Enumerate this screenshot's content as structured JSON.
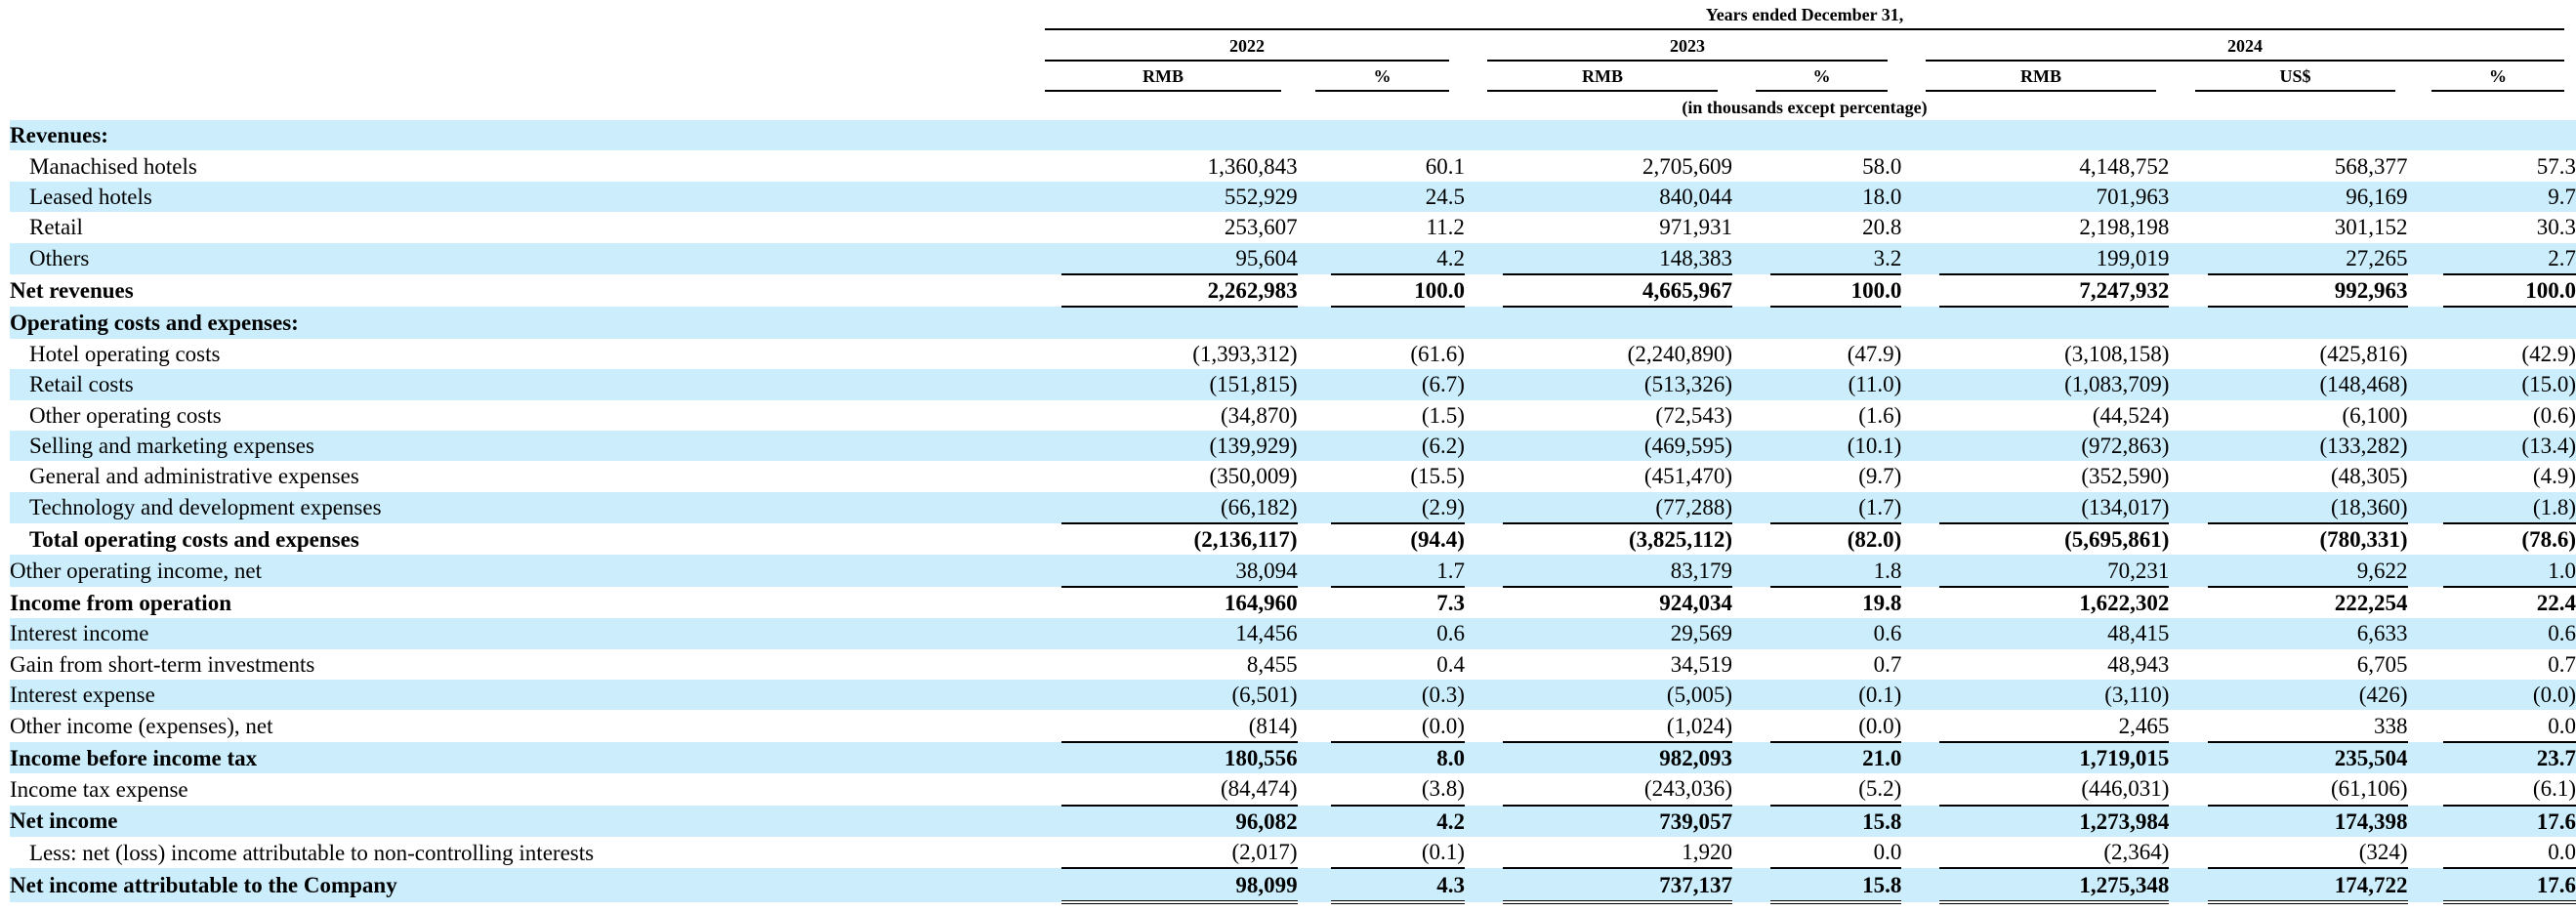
{
  "header": {
    "period_title": "Years ended December 31,",
    "years": [
      "2022",
      "2023",
      "2024"
    ],
    "col_rmb": "RMB",
    "col_pct": "%",
    "col_usd": "US$",
    "units_note": "(in thousands except percentage)"
  },
  "rows": [
    {
      "label": "Revenues:",
      "cells": [
        "",
        "",
        "",
        "",
        "",
        "",
        ""
      ]
    },
    {
      "label": "Manachised hotels",
      "cells": [
        "1,360,843",
        "60.1",
        "2,705,609",
        "58.0",
        "4,148,752",
        "568,377",
        "57.3"
      ]
    },
    {
      "label": "Leased hotels",
      "cells": [
        "552,929",
        "24.5",
        "840,044",
        "18.0",
        "701,963",
        "96,169",
        "9.7"
      ]
    },
    {
      "label": "Retail",
      "cells": [
        "253,607",
        "11.2",
        "971,931",
        "20.8",
        "2,198,198",
        "301,152",
        "30.3"
      ]
    },
    {
      "label": "Others",
      "cells": [
        "95,604",
        "4.2",
        "148,383",
        "3.2",
        "199,019",
        "27,265",
        "2.7"
      ]
    },
    {
      "label": "Net revenues",
      "cells": [
        "2,262,983",
        "100.0",
        "4,665,967",
        "100.0",
        "7,247,932",
        "992,963",
        "100.0"
      ]
    },
    {
      "label": "Operating costs and expenses:",
      "cells": [
        "",
        "",
        "",
        "",
        "",
        "",
        ""
      ]
    },
    {
      "label": "Hotel operating costs",
      "cells": [
        "(1,393,312)",
        "(61.6)",
        "(2,240,890)",
        "(47.9)",
        "(3,108,158)",
        "(425,816)",
        "(42.9)"
      ]
    },
    {
      "label": "Retail costs",
      "cells": [
        "(151,815)",
        "(6.7)",
        "(513,326)",
        "(11.0)",
        "(1,083,709)",
        "(148,468)",
        "(15.0)"
      ]
    },
    {
      "label": "Other operating costs",
      "cells": [
        "(34,870)",
        "(1.5)",
        "(72,543)",
        "(1.6)",
        "(44,524)",
        "(6,100)",
        "(0.6)"
      ]
    },
    {
      "label": "Selling and marketing expenses",
      "cells": [
        "(139,929)",
        "(6.2)",
        "(469,595)",
        "(10.1)",
        "(972,863)",
        "(133,282)",
        "(13.4)"
      ]
    },
    {
      "label": "General and administrative expenses",
      "cells": [
        "(350,009)",
        "(15.5)",
        "(451,470)",
        "(9.7)",
        "(352,590)",
        "(48,305)",
        "(4.9)"
      ]
    },
    {
      "label": "Technology and development expenses",
      "cells": [
        "(66,182)",
        "(2.9)",
        "(77,288)",
        "(1.7)",
        "(134,017)",
        "(18,360)",
        "(1.8)"
      ]
    },
    {
      "label": "Total operating costs and expenses",
      "cells": [
        "(2,136,117)",
        "(94.4)",
        "(3,825,112)",
        "(82.0)",
        "(5,695,861)",
        "(780,331)",
        "(78.6)"
      ]
    },
    {
      "label": "Other operating income, net",
      "cells": [
        "38,094",
        "1.7",
        "83,179",
        "1.8",
        "70,231",
        "9,622",
        "1.0"
      ]
    },
    {
      "label": "Income from operation",
      "cells": [
        "164,960",
        "7.3",
        "924,034",
        "19.8",
        "1,622,302",
        "222,254",
        "22.4"
      ]
    },
    {
      "label": "Interest income",
      "cells": [
        "14,456",
        "0.6",
        "29,569",
        "0.6",
        "48,415",
        "6,633",
        "0.6"
      ]
    },
    {
      "label": "Gain from short-term investments",
      "cells": [
        "8,455",
        "0.4",
        "34,519",
        "0.7",
        "48,943",
        "6,705",
        "0.7"
      ]
    },
    {
      "label": "Interest expense",
      "cells": [
        "(6,501)",
        "(0.3)",
        "(5,005)",
        "(0.1)",
        "(3,110)",
        "(426)",
        "(0.0)"
      ]
    },
    {
      "label": "Other income (expenses), net",
      "cells": [
        "(814)",
        "(0.0)",
        "(1,024)",
        "(0.0)",
        "2,465",
        "338",
        "0.0"
      ]
    },
    {
      "label": "Income before income tax",
      "cells": [
        "180,556",
        "8.0",
        "982,093",
        "21.0",
        "1,719,015",
        "235,504",
        "23.7"
      ]
    },
    {
      "label": "Income tax expense",
      "cells": [
        "(84,474)",
        "(3.8)",
        "(243,036)",
        "(5.2)",
        "(446,031)",
        "(61,106)",
        "(6.1)"
      ]
    },
    {
      "label": "Net income",
      "cells": [
        "96,082",
        "4.2",
        "739,057",
        "15.8",
        "1,273,984",
        "174,398",
        "17.6"
      ]
    },
    {
      "label": "Less: net (loss) income attributable to non-controlling interests",
      "cells": [
        "(2,017)",
        "(0.1)",
        "1,920",
        "0.0",
        "(2,364)",
        "(324)",
        "0.0"
      ]
    },
    {
      "label": "Net income attributable to the Company",
      "cells": [
        "98,099",
        "4.3",
        "737,137",
        "15.8",
        "1,275,348",
        "174,722",
        "17.6"
      ]
    }
  ]
}
